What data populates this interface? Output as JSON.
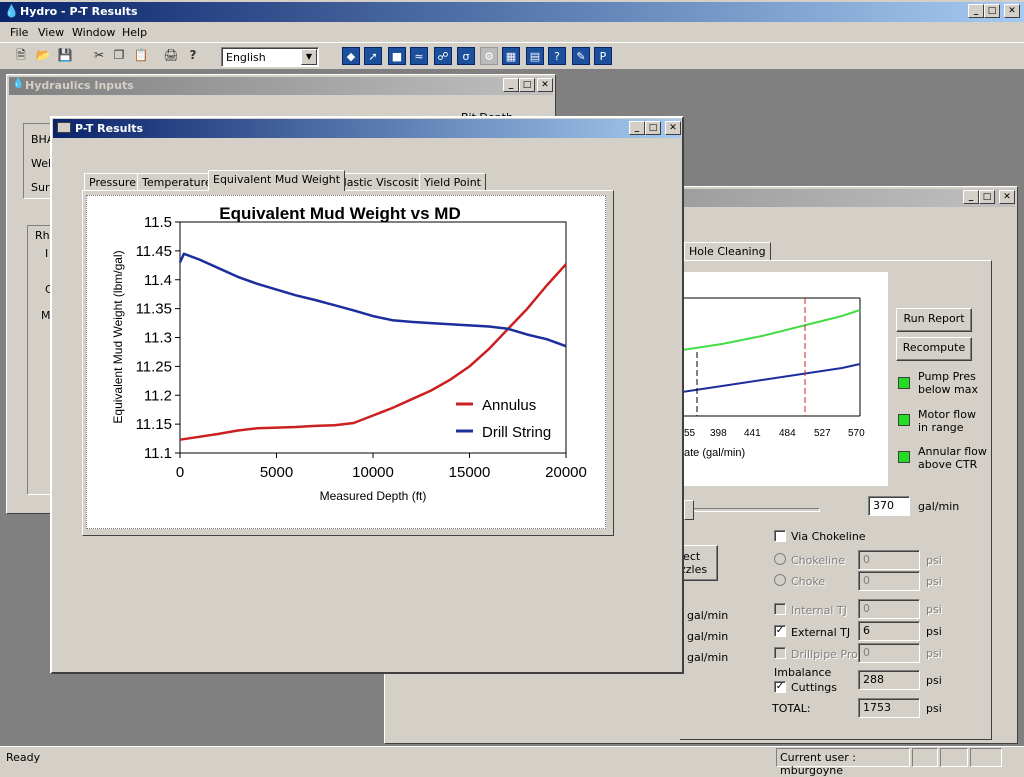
{
  "app": {
    "title": "Hydro - P-T Results",
    "menu": [
      "File",
      "View",
      "Window",
      "Help"
    ],
    "language": "English",
    "status_left": "Ready",
    "status_user": "Current user : mburgoyne"
  },
  "hydraulics_window": {
    "title": "Hydraulics Inputs",
    "labels": [
      "BHA",
      "Wel",
      "Surv",
      "Rhe",
      "I",
      "C",
      "M"
    ],
    "top_right_fragment": "Bit Depth"
  },
  "back_window": {
    "tab_label": "Hole Cleaning",
    "buttons": {
      "run_report": "Run Report",
      "recompute": "Recompute",
      "select_nozzles_1": "lect",
      "select_nozzles_2": "zzles"
    },
    "indicators": [
      {
        "label1": "Pump Pres",
        "label2": "below max"
      },
      {
        "label1": "Motor flow",
        "label2": "in range"
      },
      {
        "label1": "Annular flow",
        "label2": "above CTR"
      }
    ],
    "flow_value": "370",
    "flow_unit": "gal/min",
    "axis_ticks": [
      "55",
      "398",
      "441",
      "484",
      "527",
      "570"
    ],
    "axis_label": "ate (gal/min)",
    "gal_labels": [
      "gal/min",
      "gal/min",
      "gal/min"
    ],
    "via_chokeline": "Via Chokeline",
    "rows": [
      {
        "label": "Chokeline",
        "value": "0",
        "unit": "psi"
      },
      {
        "label": "Choke",
        "value": "0",
        "unit": "psi"
      },
      {
        "label": "Internal TJ",
        "value": "0",
        "unit": "psi"
      },
      {
        "label": "External TJ",
        "value": "6",
        "unit": "psi"
      },
      {
        "label": "Drillpipe Prot",
        "value": "0",
        "unit": "psi"
      }
    ],
    "imbalance_label": "Imbalance",
    "cuttings": {
      "label": "Cuttings",
      "value": "288",
      "unit": "psi"
    },
    "total": {
      "label": "TOTAL:",
      "value": "1753",
      "unit": "psi"
    }
  },
  "pt_window": {
    "title": "P-T Results",
    "tabs": [
      "Pressure",
      "Temperature",
      "Equivalent Mud Weight",
      "Plastic Viscosity",
      "Yield Point"
    ],
    "active_tab": "Equivalent Mud Weight"
  },
  "chart_data": {
    "type": "line",
    "title": "Equivalent Mud Weight vs MD",
    "xlabel": "Measured Depth (ft)",
    "ylabel": "Equivalent Mud Weight (lbm/gal)",
    "xlim": [
      0,
      20000
    ],
    "ylim": [
      11.1,
      11.5
    ],
    "xticks": [
      "0",
      "5000",
      "10000",
      "15000",
      "20000"
    ],
    "yticks": [
      "11.1",
      "11.15",
      "11.2",
      "11.25",
      "11.3",
      "11.35",
      "11.4",
      "11.45",
      "11.5"
    ],
    "legend_position": "bottom-right",
    "grid": false,
    "series": [
      {
        "name": "Annulus",
        "color": "#cc2020",
        "x": [
          0,
          1000,
          2000,
          3000,
          4000,
          5000,
          6000,
          7000,
          8000,
          9000,
          10000,
          11000,
          12000,
          13000,
          14000,
          15000,
          16000,
          17000,
          18000,
          19000,
          20000
        ],
        "y": [
          11.123,
          11.128,
          11.133,
          11.139,
          11.143,
          11.144,
          11.145,
          11.147,
          11.148,
          11.152,
          11.165,
          11.178,
          11.193,
          11.208,
          11.227,
          11.25,
          11.28,
          11.315,
          11.35,
          11.39,
          11.427
        ]
      },
      {
        "name": "Drill String",
        "color": "#1c2e9c",
        "x": [
          0,
          200,
          1000,
          2000,
          3000,
          4000,
          5000,
          6000,
          7000,
          8000,
          9000,
          10000,
          11000,
          12000,
          13000,
          14000,
          15000,
          16000,
          17000,
          18000,
          19000,
          20000
        ],
        "y": [
          11.43,
          11.445,
          11.435,
          11.42,
          11.405,
          11.393,
          11.383,
          11.373,
          11.365,
          11.356,
          11.347,
          11.337,
          11.33,
          11.327,
          11.325,
          11.323,
          11.321,
          11.319,
          11.315,
          11.305,
          11.297,
          11.285
        ]
      }
    ]
  }
}
